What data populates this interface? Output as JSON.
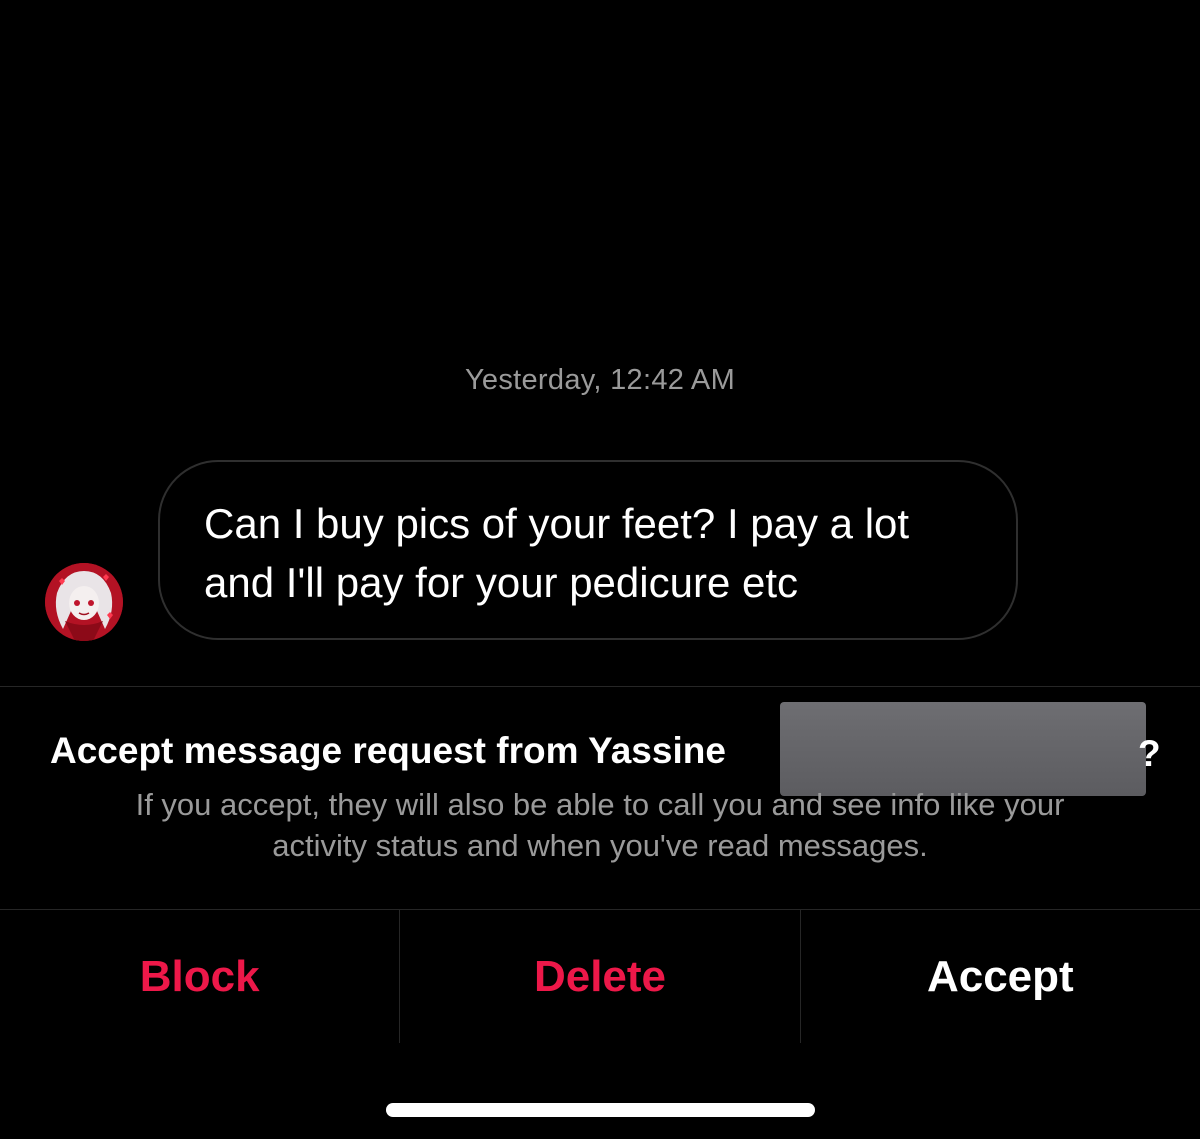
{
  "message": {
    "timestamp": "Yesterday, 12:42 AM",
    "text": "Can I buy pics of your feet? I pay a lot and I'll pay for your pedicure etc"
  },
  "request": {
    "title": "Accept message request from Yassine",
    "trailing_char": "?",
    "description_line1": "If you accept, they will also be able to call you and see info like your",
    "description_line2": "activity status and when you've read messages."
  },
  "actions": {
    "block_label": "Block",
    "delete_label": "Delete",
    "accept_label": "Accept"
  },
  "colors": {
    "background": "#000000",
    "danger": "#ed1849",
    "muted_text": "#9a9a9a",
    "divider": "#262626"
  },
  "icons": {
    "avatar": "anime-avatar-icon"
  }
}
